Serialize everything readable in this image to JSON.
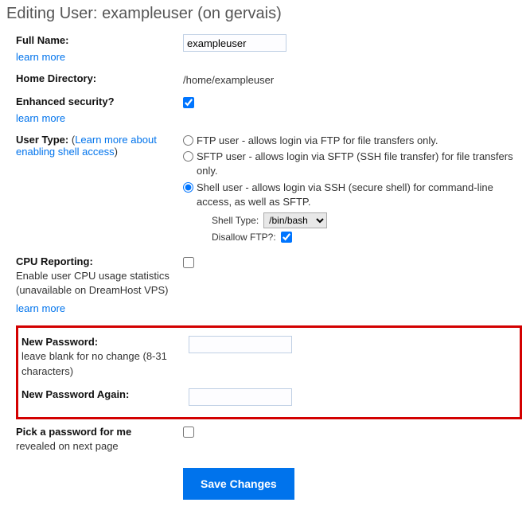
{
  "page": {
    "title_prefix": "Editing User:",
    "username": "exampleuser",
    "server_suffix": "(on gervais)"
  },
  "full_name": {
    "label": "Full Name:",
    "learn_more": "learn more",
    "value": "exampleuser"
  },
  "home_dir": {
    "label": "Home Directory:",
    "value": "/home/exampleuser"
  },
  "enhanced": {
    "label": "Enhanced security?",
    "learn_more": "learn more",
    "checked": true
  },
  "user_type": {
    "label": "User Type:",
    "link_text": "Learn more about enabling shell access",
    "options": {
      "ftp": "FTP user - allows login via FTP for file transfers only.",
      "sftp": "SFTP user - allows login via SFTP (SSH file transfer) for file transfers only.",
      "shell": "Shell user - allows login via SSH (secure shell) for command-line access, as well as SFTP."
    },
    "selected": "shell",
    "shell_type_label": "Shell Type:",
    "shell_type_value": "/bin/bash",
    "disallow_ftp_label": "Disallow FTP?:",
    "disallow_ftp_checked": true
  },
  "cpu": {
    "label": "CPU Reporting:",
    "sub": "Enable user CPU usage statistics (unavailable on DreamHost VPS)",
    "learn_more": "learn more",
    "checked": false
  },
  "new_pw": {
    "label": "New Password:",
    "sub": "leave blank for no change (8-31 characters)",
    "value": ""
  },
  "new_pw_again": {
    "label": "New Password Again:",
    "value": ""
  },
  "pick_pw": {
    "label": "Pick a password for me",
    "sub": "revealed on next page",
    "checked": false
  },
  "save": {
    "label": "Save Changes"
  }
}
